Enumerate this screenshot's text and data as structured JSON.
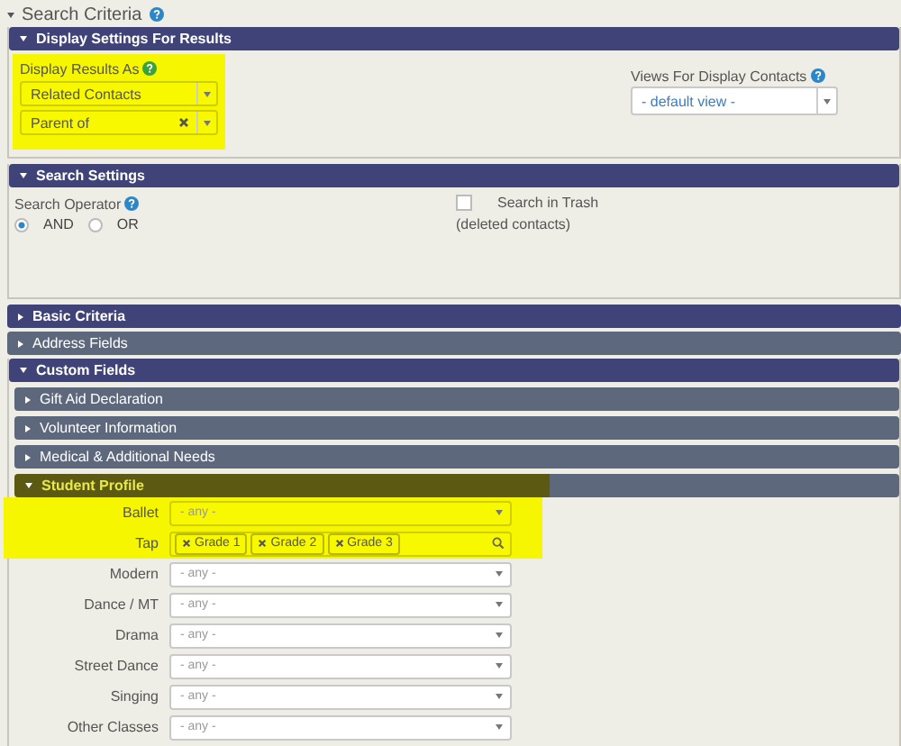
{
  "search_criteria": {
    "title": "Search Criteria",
    "expanded": true
  },
  "display_settings": {
    "title": "Display Settings For Results",
    "expanded": true,
    "highlighted": true,
    "results_label": "Display Results As",
    "results_fields": [
      {
        "value": "Related Contacts",
        "clearable": false
      },
      {
        "value": "Parent of",
        "clearable": true
      }
    ],
    "views_label": "Views For Display Contacts",
    "views_value": "- default view -"
  },
  "search_settings": {
    "title": "Search Settings",
    "expanded": true,
    "operator_label": "Search Operator",
    "options": [
      {
        "label": "AND",
        "selected": true
      },
      {
        "label": "OR",
        "selected": false
      }
    ],
    "trash": {
      "label": "Search in Trash",
      "note": "(deleted contacts)",
      "checked": false
    }
  },
  "panels": [
    {
      "title": "Basic Criteria",
      "kind": "primary",
      "expanded": false
    },
    {
      "title": "Address Fields",
      "kind": "secondary",
      "expanded": false
    }
  ],
  "custom_fields": {
    "title": "Custom Fields",
    "expanded": true,
    "subpanels": [
      {
        "title": "Gift Aid Declaration",
        "expanded": false,
        "highlighted": false
      },
      {
        "title": "Volunteer Information",
        "expanded": false,
        "highlighted": false
      },
      {
        "title": "Medical & Additional Needs",
        "expanded": false,
        "highlighted": false
      },
      {
        "title": "Student Profile",
        "expanded": true,
        "highlighted": true,
        "fields": [
          {
            "label": "Ballet",
            "kind": "select",
            "placeholder": "- any -",
            "highlighted": true
          },
          {
            "label": "Tap",
            "kind": "tags",
            "tags": [
              "Grade 1",
              "Grade 2",
              "Grade 3"
            ],
            "highlighted": true
          },
          {
            "label": "Modern",
            "kind": "select",
            "placeholder": "- any -",
            "highlighted": false
          },
          {
            "label": "Dance / MT",
            "kind": "select",
            "placeholder": "- any -",
            "highlighted": false
          },
          {
            "label": "Drama",
            "kind": "select",
            "placeholder": "- any -",
            "highlighted": false
          },
          {
            "label": "Street Dance",
            "kind": "select",
            "placeholder": "- any -",
            "highlighted": false
          },
          {
            "label": "Singing",
            "kind": "select",
            "placeholder": "- any -",
            "highlighted": false
          },
          {
            "label": "Other Classes",
            "kind": "select",
            "placeholder": "- any -",
            "highlighted": false
          }
        ]
      }
    ]
  }
}
